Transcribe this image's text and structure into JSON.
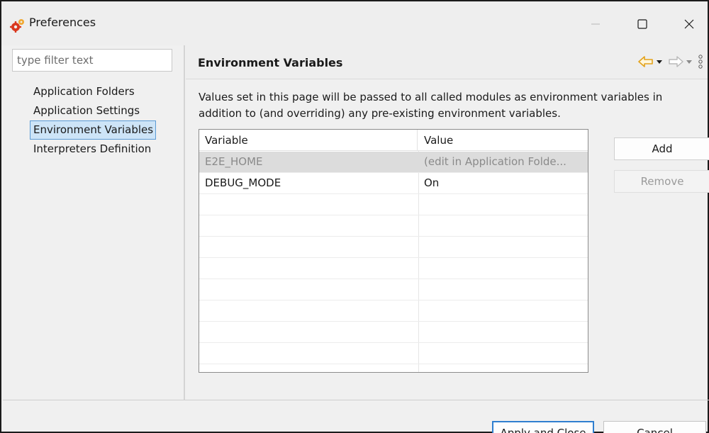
{
  "window": {
    "title": "Preferences",
    "icon": "gear-icon",
    "controls": [
      "minimize-icon",
      "maximize-icon",
      "close-icon"
    ]
  },
  "sidebar": {
    "filter_placeholder": "type filter text",
    "items": [
      {
        "label": "Application Folders",
        "selected": false
      },
      {
        "label": "Application Settings",
        "selected": false
      },
      {
        "label": "Environment Variables",
        "selected": true
      },
      {
        "label": "Interpreters Definition",
        "selected": false
      }
    ]
  },
  "page": {
    "title": "Environment Variables",
    "description": "Values set in this page will be passed to all called modules as environment variables in addition to (and overriding) any pre-existing environment variables.",
    "toolbar_icons": [
      "back-arrow-icon",
      "back-dropdown-icon",
      "forward-arrow-icon",
      "forward-dropdown-icon",
      "view-menu-icon"
    ]
  },
  "table": {
    "columns": [
      "Variable",
      "Value"
    ],
    "rows": [
      {
        "variable": "E2E_HOME",
        "value": "(edit in Application Folde...",
        "disabled": true
      },
      {
        "variable": "DEBUG_MODE",
        "value": "On",
        "disabled": false
      },
      {
        "variable": "",
        "value": "",
        "disabled": false
      },
      {
        "variable": "",
        "value": "",
        "disabled": false
      },
      {
        "variable": "",
        "value": "",
        "disabled": false
      },
      {
        "variable": "",
        "value": "",
        "disabled": false
      },
      {
        "variable": "",
        "value": "",
        "disabled": false
      },
      {
        "variable": "",
        "value": "",
        "disabled": false
      },
      {
        "variable": "",
        "value": "",
        "disabled": false
      },
      {
        "variable": "",
        "value": "",
        "disabled": false
      },
      {
        "variable": "",
        "value": "",
        "disabled": false
      }
    ]
  },
  "buttons": {
    "add": "Add",
    "remove": "Remove",
    "apply_close": "Apply and Close",
    "cancel": "Cancel"
  },
  "colors": {
    "selection_bg": "#cde4f7",
    "selection_border": "#5b9bd5",
    "back_arrow": "#e3a21a",
    "default_button_border": "#2f7fd0"
  }
}
